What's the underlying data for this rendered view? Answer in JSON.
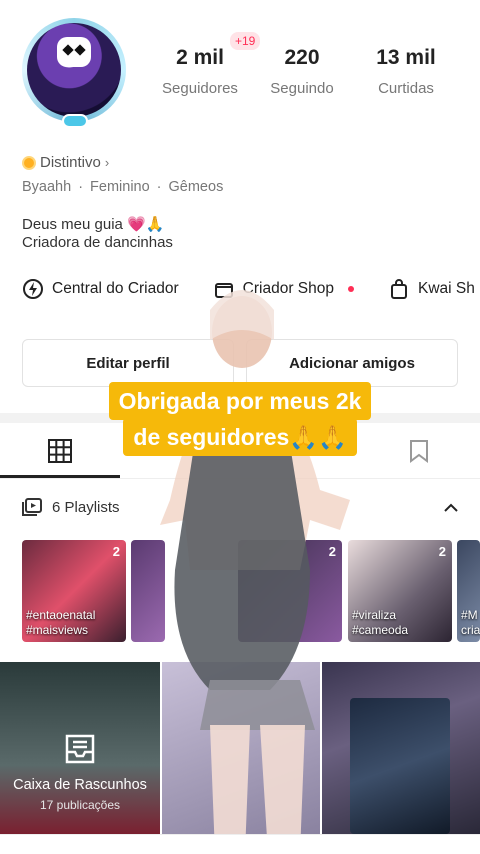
{
  "profile": {
    "stats": [
      {
        "value": "2 mil",
        "label": "Seguidores"
      },
      {
        "value": "220",
        "label": "Seguindo"
      },
      {
        "value": "13 mil",
        "label": "Curtidas"
      }
    ],
    "followers_badge": "+19",
    "badge_label": "Distintivo",
    "info": [
      "Byaahh",
      "Feminino",
      "Gêmeos"
    ],
    "bio_line1": "Deus meu guia 💗🙏",
    "bio_line2": "Criadora de dancinhas"
  },
  "links": {
    "creator_center": "Central do Criador",
    "creator_shop": "Criador Shop",
    "kwai_shop": "Kwai Sh"
  },
  "buttons": {
    "edit_profile": "Editar perfil",
    "add_friends": "Adicionar amigos"
  },
  "playlists": {
    "header": "6 Playlists",
    "cards": [
      {
        "count": "2",
        "tag1": "#entaoenatal",
        "tag2": "#maisviews"
      },
      {
        "count": "",
        "tag1": "",
        "tag2": ""
      },
      {
        "count": "2",
        "tag1": "",
        "tag2": ""
      },
      {
        "count": "2",
        "tag1": "#viraliza",
        "tag2": "#cameoda"
      },
      {
        "count": "",
        "tag1": "#M",
        "tag2": "cria"
      }
    ]
  },
  "drafts": {
    "title": "Caixa de Rascunhos",
    "subtitle": "17 publicações"
  },
  "overlay": {
    "caption_line1": "Obrigada por meus 2k",
    "caption_line2": "de seguidores🙏🙏"
  },
  "colors": {
    "accent_red": "#ff2e55",
    "caption_bg": "#f6b90a"
  }
}
